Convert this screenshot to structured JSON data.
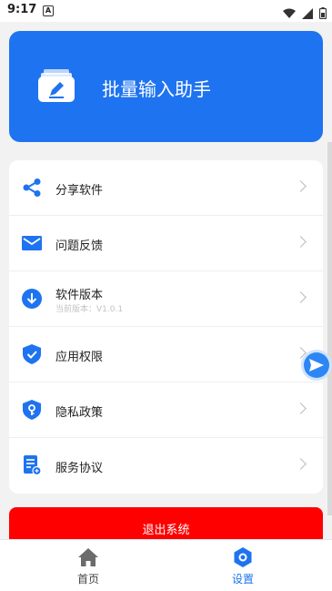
{
  "status_bar": {
    "time": "9:17",
    "notification_letter": "A"
  },
  "header": {
    "title": "批量输入助手",
    "accent_color": "#1e73f0"
  },
  "menu": {
    "items": [
      {
        "label": "分享软件",
        "icon": "share-icon"
      },
      {
        "label": "问题反馈",
        "icon": "mail-icon"
      },
      {
        "label": "软件版本",
        "sublabel": "当前版本：V1.0.1",
        "icon": "download-icon"
      },
      {
        "label": "应用权限",
        "icon": "shield-check-icon"
      },
      {
        "label": "隐私政策",
        "icon": "shield-key-icon"
      },
      {
        "label": "服务协议",
        "icon": "document-icon"
      }
    ]
  },
  "logout": {
    "label": "退出系统",
    "color": "#ff0000"
  },
  "tabbar": {
    "tabs": [
      {
        "label": "首页",
        "icon": "home-icon",
        "active": false
      },
      {
        "label": "设置",
        "icon": "settings-icon",
        "active": true
      }
    ]
  }
}
